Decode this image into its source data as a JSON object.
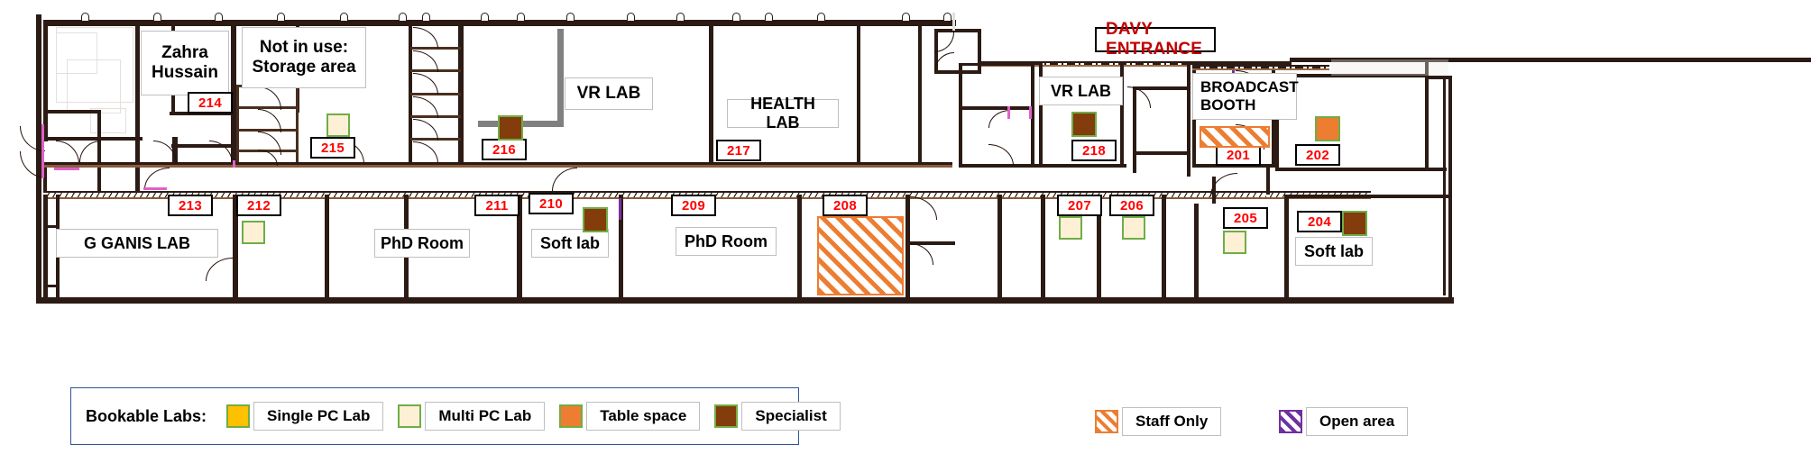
{
  "title_tag": {
    "label": "DAVY ENTRANCE",
    "color": "#c00000"
  },
  "rooms": [
    {
      "id": "zahra",
      "label": "Zahra\nHussain",
      "number": null
    },
    {
      "id": "storage",
      "label": "Not in use:\nStorage area",
      "number": null
    },
    {
      "id": "r214",
      "label": null,
      "number": "214"
    },
    {
      "id": "r215",
      "label": null,
      "number": "215"
    },
    {
      "id": "vrlab_216",
      "label": "VR LAB",
      "number": "216"
    },
    {
      "id": "healthlab",
      "label": "HEALTH LAB",
      "number": "217"
    },
    {
      "id": "vrlab_218",
      "label": "VR LAB",
      "number": "218"
    },
    {
      "id": "broadcast",
      "label": "BROADCAST\nBOOTH",
      "number": "201"
    },
    {
      "id": "r202",
      "label": null,
      "number": "202"
    },
    {
      "id": "ganis",
      "label": "G GANIS LAB",
      "number": "213"
    },
    {
      "id": "r212",
      "label": null,
      "number": "212"
    },
    {
      "id": "phd_211",
      "label": "PhD Room",
      "number": "211"
    },
    {
      "id": "soft_210",
      "label": "Soft lab",
      "number": "210"
    },
    {
      "id": "phd_209",
      "label": "PhD Room",
      "number": "209"
    },
    {
      "id": "r208",
      "label": null,
      "number": "208"
    },
    {
      "id": "r207",
      "label": null,
      "number": "207"
    },
    {
      "id": "r206",
      "label": null,
      "number": "206"
    },
    {
      "id": "r205",
      "label": null,
      "number": "205"
    },
    {
      "id": "soft_204",
      "label": "Soft lab",
      "number": "204"
    }
  ],
  "room_numbers": {
    "n214": "214",
    "n215": "215",
    "n216": "216",
    "n217": "217",
    "n218": "218",
    "n201": "201",
    "n202": "202",
    "n213": "213",
    "n212": "212",
    "n211": "211",
    "n210": "210",
    "n209": "209",
    "n208": "208",
    "n207": "207",
    "n206": "206",
    "n205": "205",
    "n204": "204"
  },
  "room_labels": {
    "zahra": "Zahra\nHussain",
    "storage": "Not in use:\nStorage area",
    "vrlab_mid": "VR LAB",
    "health_lab": "HEALTH LAB",
    "vrlab_right": "VR LAB",
    "broadcast_booth": "BROADCAST\nBOOTH",
    "ganis_lab": "G GANIS LAB",
    "phd_room_left": "PhD Room",
    "soft_lab_mid": "Soft lab",
    "phd_room_right": "PhD Room",
    "soft_lab_right": "Soft lab"
  },
  "legend": {
    "bookable_title": "Bookable Labs:",
    "items": [
      {
        "key": "single-pc",
        "label": "Single PC Lab",
        "color": "#ffc000",
        "border": "#70ad47",
        "pattern": "solid"
      },
      {
        "key": "multi-pc",
        "label": "Multi PC Lab",
        "color": "#fdf0d5",
        "border": "#70ad47",
        "pattern": "solid"
      },
      {
        "key": "table",
        "label": "Table space",
        "color": "#ed7d31",
        "border": "#70ad47",
        "pattern": "solid"
      },
      {
        "key": "specialist",
        "label": "Specialist",
        "color": "#833c0c",
        "border": "#70ad47",
        "pattern": "solid"
      }
    ],
    "extra": [
      {
        "key": "staff-only",
        "label": "Staff Only",
        "color": "#ed7d31",
        "border": "#ed7d31",
        "pattern": "hatch"
      },
      {
        "key": "open-area",
        "label": "Open area",
        "color": "#7030a0",
        "border": "#7030a0",
        "pattern": "hatch"
      }
    ]
  },
  "swatches": [
    {
      "room": "215",
      "type": "multi-pc"
    },
    {
      "room": "216",
      "type": "specialist"
    },
    {
      "room": "218",
      "type": "specialist"
    },
    {
      "room": "202",
      "type": "table"
    },
    {
      "room": "212",
      "type": "multi-pc"
    },
    {
      "room": "210",
      "type": "specialist"
    },
    {
      "room": "207",
      "type": "multi-pc"
    },
    {
      "room": "206",
      "type": "multi-pc"
    },
    {
      "room": "205",
      "type": "multi-pc"
    },
    {
      "room": "204",
      "type": "specialist"
    }
  ],
  "hatched_areas": [
    {
      "room": "201",
      "type": "staff-only"
    },
    {
      "room": "208",
      "type": "staff-only"
    }
  ]
}
